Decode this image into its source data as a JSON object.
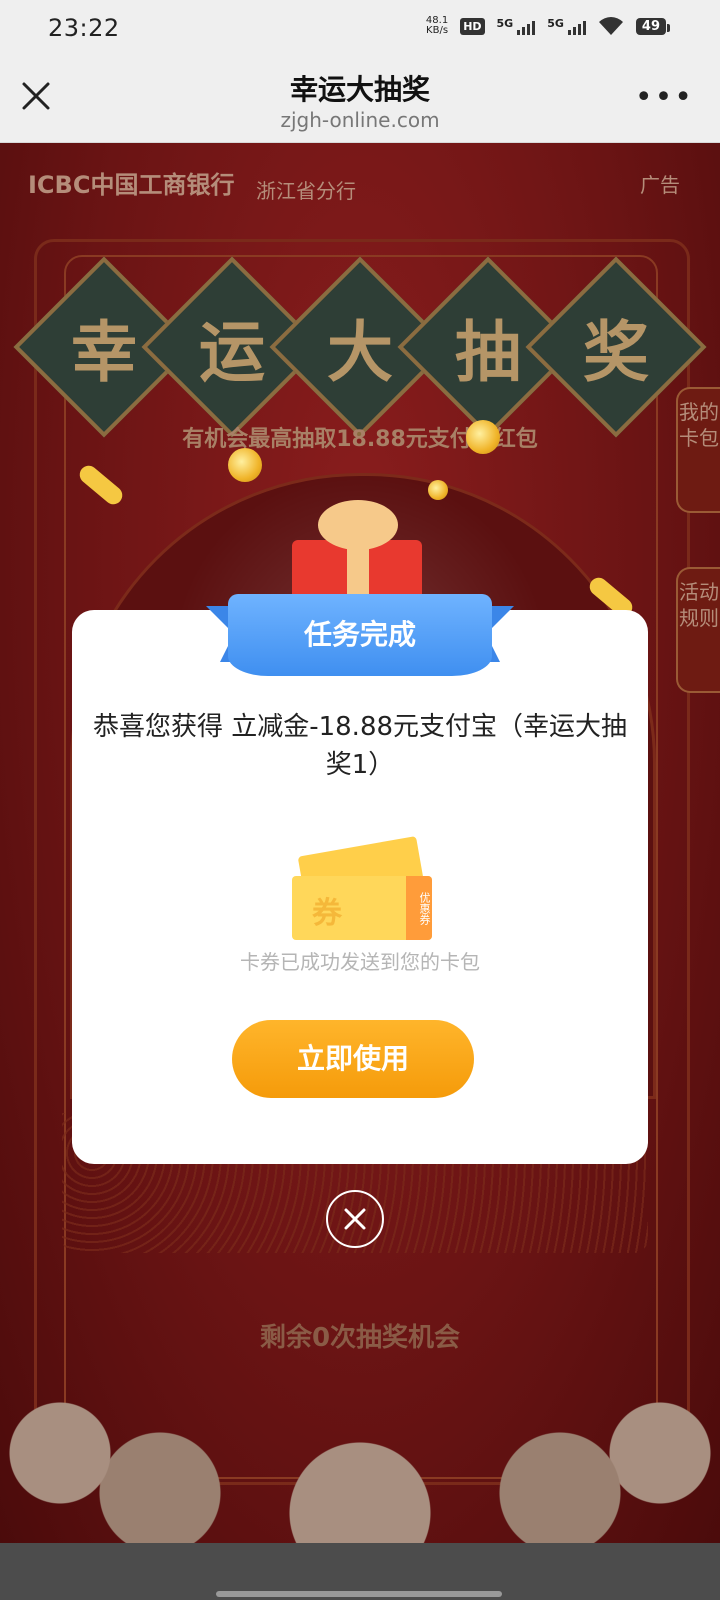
{
  "status_bar": {
    "time": "23:22",
    "net_speed": "48.1",
    "net_unit": "KB/s",
    "hd_badge": "HD",
    "sim1": "5G",
    "sim2": "5G",
    "battery": "49"
  },
  "browser": {
    "title": "幸运大抽奖",
    "url": "zjgh-online.com",
    "more": "•••"
  },
  "page": {
    "brand": "ICBC中国工商银行",
    "brand_sub": "浙江省分行",
    "ad_label": "广告",
    "title_chars": [
      "幸",
      "运",
      "大",
      "抽",
      "奖"
    ],
    "subtitle": "有机会最高抽取18.88元支付宝红包",
    "side_tab_cards": "我的卡包",
    "side_tab_rules": "活动规则",
    "remaining": "剩余0次抽奖机会"
  },
  "modal": {
    "banner": "任务完成",
    "message": "恭喜您获得 立减金-18.88元支付宝（幸运大抽奖1）",
    "coupon_word": "券",
    "coupon_stub": "优惠券",
    "sent_note": "卡券已成功发送到您的卡包",
    "use_button": "立即使用"
  },
  "colors": {
    "accent_orange": "#f59b0a",
    "banner_blue": "#3f8ff0",
    "page_red": "#6b1414"
  }
}
